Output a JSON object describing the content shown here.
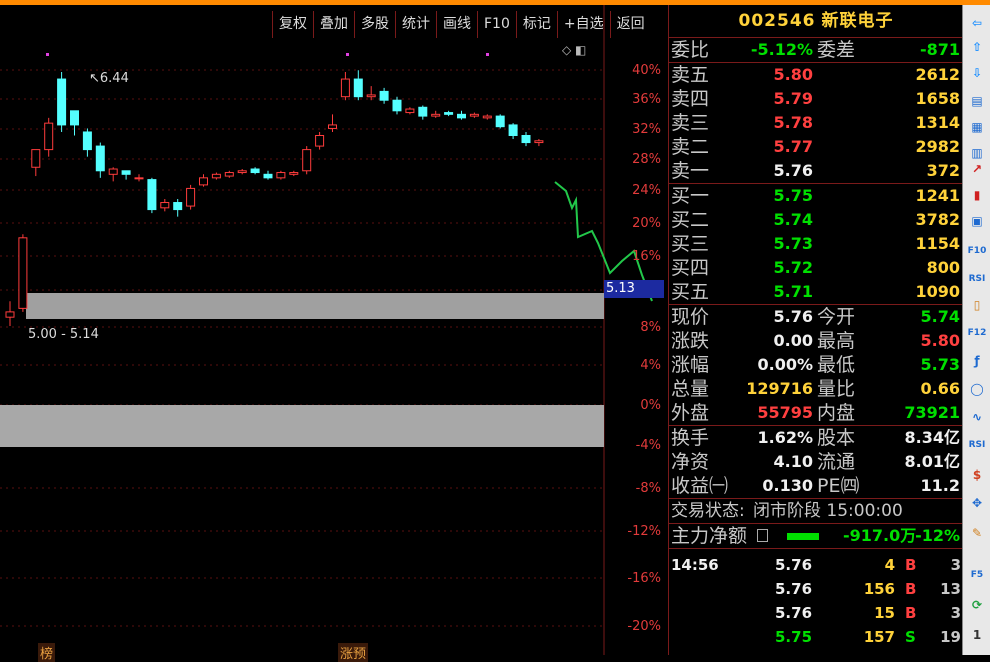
{
  "toolbar": [
    "复权",
    "叠加",
    "多股",
    "统计",
    "画线",
    "F10",
    "标记",
    "+自选",
    "返回"
  ],
  "stock": {
    "code": "002546",
    "name": "新联电子"
  },
  "chart": {
    "hi_label": "6.44",
    "range_label": "5.00 - 5.14",
    "price_tag": "5.13",
    "pct_axis": [
      "40%",
      "36%",
      "32%",
      "28%",
      "24%",
      "20%",
      "16%",
      "12%",
      "8%",
      "4%",
      "0%",
      "-4%",
      "-8%",
      "-12%",
      "-16%",
      "-20%"
    ],
    "tags": [
      "榜",
      "涨预"
    ],
    "mini_buttons": "◇ ◧"
  },
  "chart_data": {
    "type": "candlestick",
    "title": "",
    "candles": [
      {
        "o": 5.05,
        "c": 5.08,
        "h": 5.14,
        "l": 5.0
      },
      {
        "o": 5.1,
        "c": 5.5,
        "h": 5.52,
        "l": 5.08
      },
      {
        "o": 5.9,
        "c": 6.0,
        "h": 6.0,
        "l": 5.85
      },
      {
        "o": 6.0,
        "c": 6.15,
        "h": 6.18,
        "l": 5.96
      },
      {
        "o": 6.4,
        "c": 6.14,
        "h": 6.44,
        "l": 6.1
      },
      {
        "o": 6.22,
        "c": 6.14,
        "h": 6.22,
        "l": 6.08
      },
      {
        "o": 6.1,
        "c": 6.0,
        "h": 6.12,
        "l": 5.96
      },
      {
        "o": 6.02,
        "c": 5.88,
        "h": 6.04,
        "l": 5.84
      },
      {
        "o": 5.86,
        "c": 5.89,
        "h": 5.9,
        "l": 5.82
      },
      {
        "o": 5.88,
        "c": 5.86,
        "h": 5.88,
        "l": 5.83
      },
      {
        "o": 5.84,
        "c": 5.84,
        "h": 5.86,
        "l": 5.82
      },
      {
        "o": 5.83,
        "c": 5.66,
        "h": 5.84,
        "l": 5.64
      },
      {
        "o": 5.67,
        "c": 5.7,
        "h": 5.72,
        "l": 5.65
      },
      {
        "o": 5.7,
        "c": 5.66,
        "h": 5.72,
        "l": 5.62
      },
      {
        "o": 5.68,
        "c": 5.78,
        "h": 5.8,
        "l": 5.66
      },
      {
        "o": 5.8,
        "c": 5.84,
        "h": 5.86,
        "l": 5.79
      },
      {
        "o": 5.84,
        "c": 5.86,
        "h": 5.87,
        "l": 5.83
      },
      {
        "o": 5.85,
        "c": 5.87,
        "h": 5.88,
        "l": 5.84
      },
      {
        "o": 5.87,
        "c": 5.88,
        "h": 5.89,
        "l": 5.86
      },
      {
        "o": 5.89,
        "c": 5.87,
        "h": 5.9,
        "l": 5.86
      },
      {
        "o": 5.86,
        "c": 5.84,
        "h": 5.88,
        "l": 5.83
      },
      {
        "o": 5.84,
        "c": 5.87,
        "h": 5.88,
        "l": 5.83
      },
      {
        "o": 5.86,
        "c": 5.87,
        "h": 5.88,
        "l": 5.85
      },
      {
        "o": 5.88,
        "c": 6.0,
        "h": 6.02,
        "l": 5.86
      },
      {
        "o": 6.02,
        "c": 6.08,
        "h": 6.1,
        "l": 6.0
      },
      {
        "o": 6.12,
        "c": 6.14,
        "h": 6.2,
        "l": 6.1
      },
      {
        "o": 6.3,
        "c": 6.4,
        "h": 6.44,
        "l": 6.28
      },
      {
        "o": 6.4,
        "c": 6.3,
        "h": 6.45,
        "l": 6.28
      },
      {
        "o": 6.3,
        "c": 6.31,
        "h": 6.36,
        "l": 6.28
      },
      {
        "o": 6.33,
        "c": 6.28,
        "h": 6.35,
        "l": 6.26
      },
      {
        "o": 6.28,
        "c": 6.22,
        "h": 6.3,
        "l": 6.2
      },
      {
        "o": 6.21,
        "c": 6.23,
        "h": 6.24,
        "l": 6.2
      },
      {
        "o": 6.24,
        "c": 6.19,
        "h": 6.25,
        "l": 6.17
      },
      {
        "o": 6.19,
        "c": 6.2,
        "h": 6.22,
        "l": 6.18
      },
      {
        "o": 6.21,
        "c": 6.2,
        "h": 6.22,
        "l": 6.19
      },
      {
        "o": 6.2,
        "c": 6.18,
        "h": 6.22,
        "l": 6.17
      },
      {
        "o": 6.19,
        "c": 6.2,
        "h": 6.21,
        "l": 6.18
      },
      {
        "o": 6.18,
        "c": 6.19,
        "h": 6.2,
        "l": 6.17
      },
      {
        "o": 6.19,
        "c": 6.13,
        "h": 6.2,
        "l": 6.12
      },
      {
        "o": 6.14,
        "c": 6.08,
        "h": 6.15,
        "l": 6.06
      },
      {
        "o": 6.08,
        "c": 6.04,
        "h": 6.1,
        "l": 6.02
      },
      {
        "o": 6.04,
        "c": 6.05,
        "h": 6.06,
        "l": 6.02
      }
    ]
  },
  "quote": {
    "weibi": {
      "label": "委比",
      "value": "-5.12%",
      "label2": "委差",
      "value2": "-871"
    },
    "sells": [
      {
        "label": "卖五",
        "price": "5.80",
        "vol": "2612"
      },
      {
        "label": "卖四",
        "price": "5.79",
        "vol": "1658"
      },
      {
        "label": "卖三",
        "price": "5.78",
        "vol": "1314"
      },
      {
        "label": "卖二",
        "price": "5.77",
        "vol": "2982"
      },
      {
        "label": "卖一",
        "price": "5.76",
        "vol": "372"
      }
    ],
    "buys": [
      {
        "label": "买一",
        "price": "5.75",
        "vol": "1241"
      },
      {
        "label": "买二",
        "price": "5.74",
        "vol": "3782"
      },
      {
        "label": "买三",
        "price": "5.73",
        "vol": "1154"
      },
      {
        "label": "买四",
        "price": "5.72",
        "vol": "800"
      },
      {
        "label": "买五",
        "price": "5.71",
        "vol": "1090"
      }
    ],
    "stats1": [
      {
        "l1": "现价",
        "v1": "5.76",
        "l2": "今开",
        "v2": "5.74",
        "c1": "white",
        "c2": "green"
      },
      {
        "l1": "涨跌",
        "v1": "0.00",
        "l2": "最高",
        "v2": "5.80",
        "c1": "white",
        "c2": "red"
      },
      {
        "l1": "涨幅",
        "v1": "0.00%",
        "l2": "最低",
        "v2": "5.73",
        "c1": "white",
        "c2": "green"
      },
      {
        "l1": "总量",
        "v1": "129716",
        "l2": "量比",
        "v2": "0.66",
        "c1": "yellow",
        "c2": "yellow"
      },
      {
        "l1": "外盘",
        "v1": "55795",
        "l2": "内盘",
        "v2": "73921",
        "c1": "red",
        "c2": "green"
      }
    ],
    "stats2": [
      {
        "l1": "换手",
        "v1": "1.62%",
        "l2": "股本",
        "v2": "8.34亿",
        "c1": "white",
        "c2": "white"
      },
      {
        "l1": "净资",
        "v1": "4.10",
        "l2": "流通",
        "v2": "8.01亿",
        "c1": "white",
        "c2": "white"
      },
      {
        "l1": "收益㈠",
        "v1": "0.130",
        "l2": "PE㈣",
        "v2": "11.2",
        "c1": "white",
        "c2": "white"
      }
    ],
    "status": {
      "label": "交易状态:",
      "value": "闭市阶段 15:00:00"
    },
    "flow": {
      "label": "主力净额",
      "value": "-917.0万",
      "pct": "-12%"
    },
    "ticks": [
      {
        "t": "14:56",
        "p": "5.76",
        "q": "4",
        "s": "B",
        "n": "3",
        "pc": "white",
        "sc": "red"
      },
      {
        "t": "",
        "p": "5.76",
        "q": "156",
        "s": "B",
        "n": "13",
        "pc": "white",
        "sc": "red"
      },
      {
        "t": "",
        "p": "5.76",
        "q": "15",
        "s": "B",
        "n": "3",
        "pc": "white",
        "sc": "red"
      },
      {
        "t": "",
        "p": "5.75",
        "q": "157",
        "s": "S",
        "n": "19",
        "pc": "green",
        "sc": "green"
      }
    ]
  },
  "side_icons": [
    "left-arrow-icon",
    "up-arrow-icon",
    "down-arrow-icon",
    "list-icon",
    "grid-icon",
    "table-icon",
    "line-chart-icon",
    "candle-chart-icon",
    "multi-window-icon",
    "f10-icon",
    "rsi-box-icon",
    "doc-icon",
    "f12-icon",
    "x-chart-icon",
    "circle-icon",
    "wave-icon",
    "rsi-icon",
    "dollar-icon",
    "move-icon",
    "pen-icon",
    "f5-icon",
    "refresh-icon",
    "page-1"
  ]
}
